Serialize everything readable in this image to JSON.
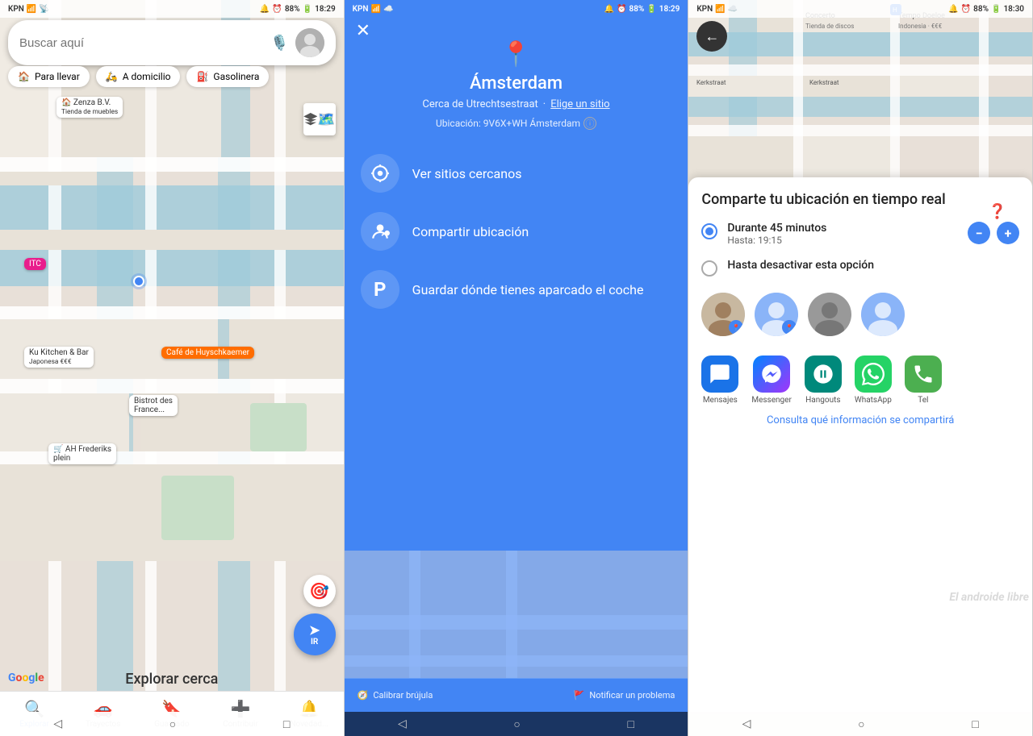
{
  "panels": {
    "panel1": {
      "status": {
        "carrier": "KPN",
        "time": "18:29",
        "battery": "88%"
      },
      "search": {
        "placeholder": "Buscar aquí"
      },
      "categories": [
        {
          "icon": "🏠",
          "label": "Para llevar"
        },
        {
          "icon": "🛵",
          "label": "A domicilio"
        },
        {
          "icon": "⛽",
          "label": "Gasolinera"
        }
      ],
      "explore_label": "Explorar cerca",
      "nav": {
        "items": [
          {
            "icon": "🔍",
            "label": "Explorar",
            "active": true
          },
          {
            "icon": "🚗",
            "label": "Trayectos",
            "active": false
          },
          {
            "icon": "🔖",
            "label": "Guardado",
            "active": false
          },
          {
            "icon": "➕",
            "label": "Contribuir",
            "active": false
          },
          {
            "icon": "🔔",
            "label": "Novedad...",
            "active": false
          }
        ]
      },
      "nav_btn_label": "IR"
    },
    "panel2": {
      "status": {
        "carrier": "KPN",
        "time": "18:29",
        "battery": "88%"
      },
      "title": "Ámsterdam",
      "subtitle": "Cerca de Utrechtsestraat",
      "choose_site": "Elige un sitio",
      "location_code": "Ubicación: 9V6X+WH Ámsterdam",
      "menu_items": [
        {
          "icon": "📍",
          "label": "Ver sitios cercanos"
        },
        {
          "icon": "👤",
          "label": "Compartir ubicación"
        },
        {
          "icon": "P",
          "label": "Guardar dónde tienes aparcado el coche"
        }
      ],
      "bottom": {
        "calibrate": "Calibrar brújula",
        "report": "Notificar un problema"
      }
    },
    "panel3": {
      "status": {
        "carrier": "KPN",
        "time": "18:30",
        "battery": "88%"
      },
      "sheet": {
        "title": "Comparte tu ubicación en tiempo real",
        "option1": {
          "main": "Durante 45 minutos",
          "sub": "Hasta: 19:15"
        },
        "option2": {
          "main": "Hasta desactivar esta opción"
        }
      },
      "apps": [
        {
          "name": "Mensajes",
          "color": "#1a73e8"
        },
        {
          "name": "Messenger",
          "color": "#7c4dff"
        },
        {
          "name": "Hangouts",
          "color": "#00897b"
        },
        {
          "name": "WhatsApp",
          "color": "#25d366"
        },
        {
          "name": "Tel",
          "color": "#4caf50"
        }
      ],
      "info_link": "Consulta qué información se compartirá",
      "watermark": "El androide libre"
    }
  }
}
